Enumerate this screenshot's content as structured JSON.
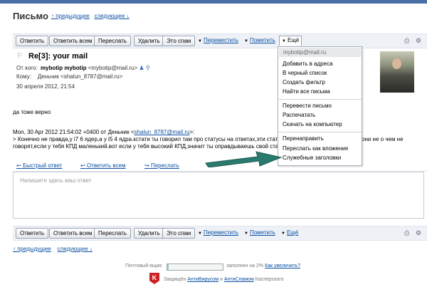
{
  "page_title": "Письмо",
  "nav": {
    "prev": "↑ предыдущее",
    "next": "следующее ↓"
  },
  "toolbar": {
    "reply": "Ответить",
    "reply_all": "Ответить всем",
    "forward": "Переслать",
    "delete": "Удалить",
    "spam": "Это спам",
    "move": "Переместить",
    "mark": "Пометить",
    "more": "Ещё",
    "print_icon": "printer-icon",
    "settings_icon": "settings-icon"
  },
  "message": {
    "subject": "Re[3]: your mail",
    "from_label": "От кого:",
    "from_name": "mybotip mybotip",
    "from_email": "<mybotip@mail.ru>",
    "to_label": "Кому:",
    "to_value": "Деньчик <shalun_8787@mail.ru>",
    "date": "30 апреля 2012, 21:54",
    "body_line1": "да тоже верно",
    "quote_header_prefix": "Mon, 30 Apr 2012 21:54:02 +0400 от Деньчик <",
    "quote_header_email": "shalun_8787@mail.ru",
    "quote_header_suffix": ">:",
    "quote_line1": "> Конечно не правда,у i7 6 ядер,а у i5 4 ядра.кстати ты говорил там про статусы на ответах,эти стату",
    "quote_line1_tail": "они не о чем не",
    "quote_line2": "говорят,если у тебя КПД маленький.вот если у тебя высокий КПД,значит ты оправдываешь свой ста"
  },
  "menu": {
    "email": "mybotip@mail.ru",
    "items": [
      "Добавить в адреса",
      "В черный список",
      "Создать фильтр",
      "Найти все письма",
      "Перевести письмо",
      "Распечатать",
      "Скачать на компьютер",
      "Перенаправить",
      "Переслать как вложение",
      "Служебные заголовки"
    ]
  },
  "reply_bar": {
    "quick_reply": "Быстрый ответ",
    "reply_all": "Ответить всем",
    "forward": "Переслать"
  },
  "reply_placeholder": "Напишите здесь ваш ответ",
  "footer": {
    "mailbox_label": "Почтовый ящик:",
    "quota_fill_percent": 2,
    "quota_text": "заполнен на 2%",
    "increase_link": "Как увеличить?",
    "protected_prefix": "Защищён",
    "antivirus": "АнтиВирусом",
    "and": "и",
    "antispam": "АнтиСпамом",
    "kaspersky": "Касперского",
    "kaspersky_logo_letter": "K"
  },
  "colors": {
    "link": "#0b4fa0",
    "arrow": "#2a7a6e",
    "toolbar_bg": "#eef2f7"
  }
}
